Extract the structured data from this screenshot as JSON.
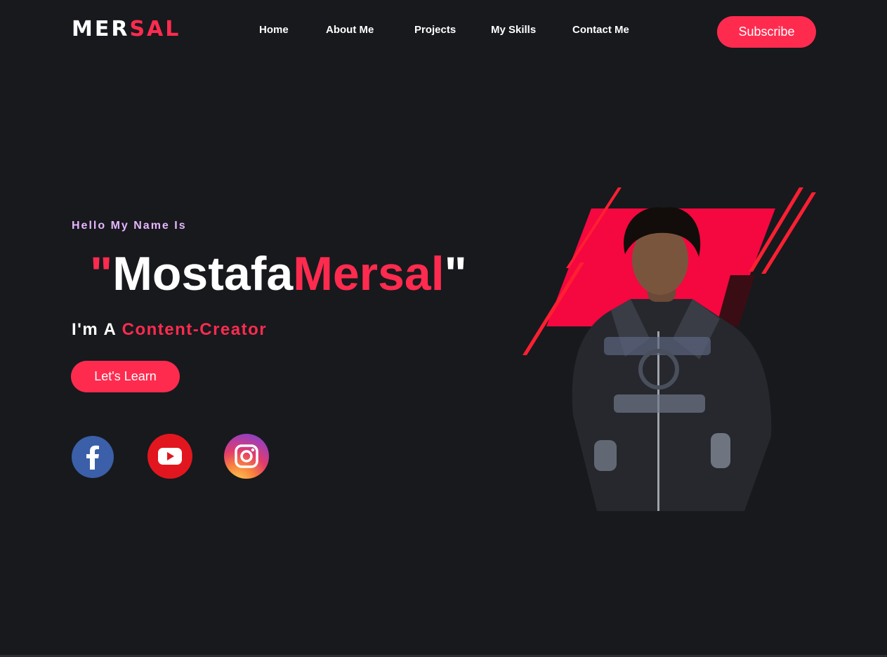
{
  "header": {
    "logo_part1": "MER",
    "logo_part2": "SAL",
    "nav": [
      "Home",
      "About Me",
      "Projects",
      "My Skills",
      "Contact Me"
    ],
    "subscribe_label": "Subscribe"
  },
  "hero": {
    "greeting": "Hello My Name Is",
    "open_quote": "\"",
    "first_name": "Mostafa",
    "last_name": "Mersal",
    "close_quote": "\"",
    "role_prefix": "I'm A",
    "role": "Content-Creator",
    "cta_label": "Let's Learn"
  },
  "social": [
    {
      "name": "facebook-icon"
    },
    {
      "name": "youtube-icon"
    },
    {
      "name": "instagram-icon"
    }
  ],
  "colors": {
    "background": "#17191d",
    "accent": "#ff2b4f",
    "greeting": "#e7b5ff"
  }
}
